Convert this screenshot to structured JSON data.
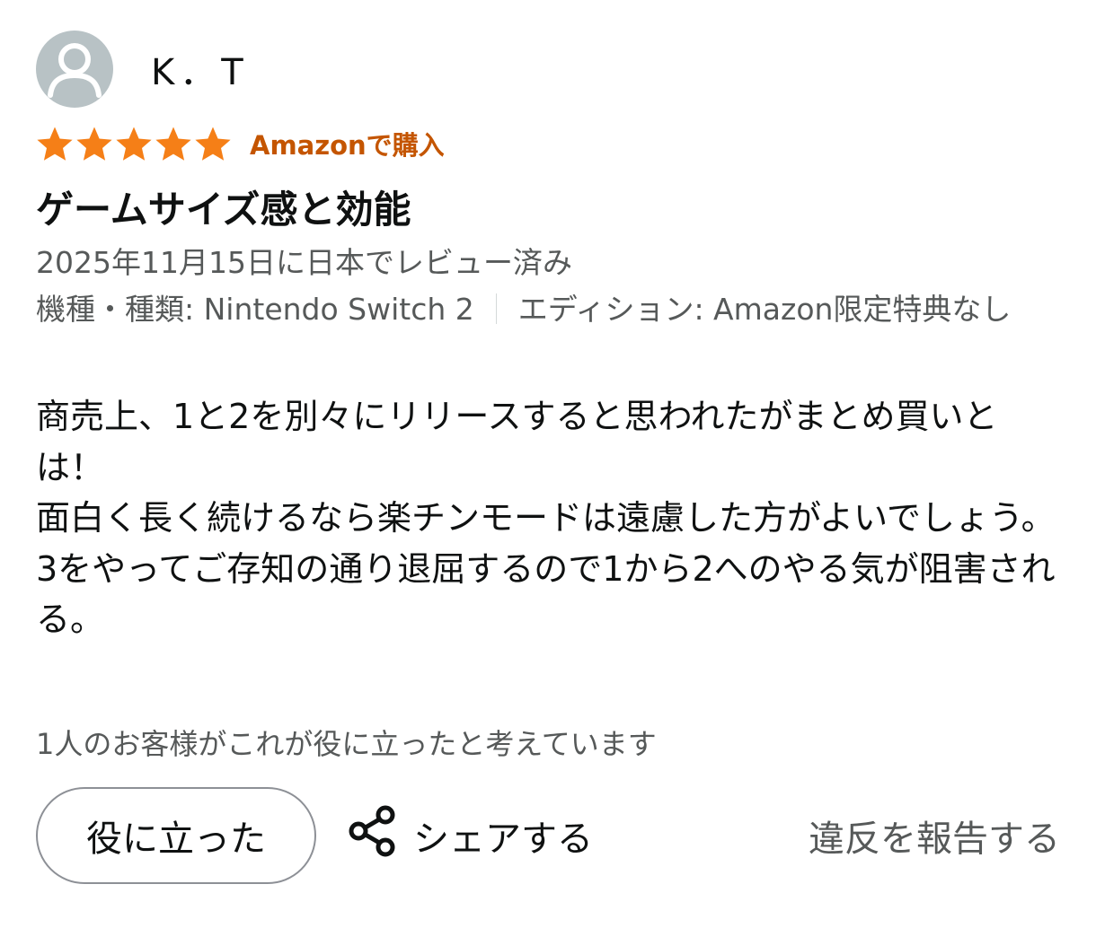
{
  "review": {
    "profile_name": "K．T",
    "rating": 5,
    "rating_max": 5,
    "verified_label": "Amazonで購入",
    "title": "ゲームサイズ感と効能",
    "date": "2025年11月15日に日本でレビュー済み",
    "variant": {
      "platform": "機種・種類: Nintendo Switch 2",
      "edition": "エディション: Amazon限定特典なし"
    },
    "body": "商売上、1と2を別々にリリースすると思われたがまとめ買いとは！\n面白く長く続けるなら楽チンモードは遠慮した方がよいでしょう。\n3をやってご存知の通り退屈するので1から2へのやる気が阻害される。",
    "helpful_count_text": "1人のお客様がこれが役に立ったと考えています"
  },
  "actions": {
    "helpful_label": "役に立った",
    "share_label": "シェアする",
    "report_label": "違反を報告する"
  },
  "icons": {
    "avatar": "person-icon",
    "star": "star-icon",
    "share": "share-icon"
  },
  "colors": {
    "star": "#f57f17",
    "verified": "#c45500",
    "text": "#0f1111",
    "secondary_text": "#565959",
    "avatar_bg": "#b8c2c5",
    "button_border": "#8d9096"
  }
}
